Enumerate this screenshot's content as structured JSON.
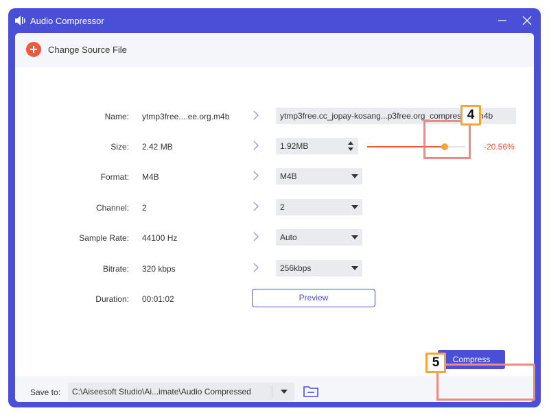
{
  "window": {
    "title": "Audio Compressor",
    "accent_color": "#4a4fd8",
    "icons": {
      "app": "audio-compress-icon",
      "minimize": "minimize-icon",
      "close": "close-icon"
    }
  },
  "toolbar": {
    "change_source_label": "Change Source File",
    "add_icon": "plus-icon"
  },
  "form": {
    "rows": [
      {
        "label": "Name:",
        "original": "ytmp3free....ee.org.m4b",
        "output": "ytmp3free.cc_jopay-kosang...p3free.org_compressed.m4b"
      },
      {
        "label": "Size:",
        "original": "2.42 MB",
        "output": "1.92MB"
      },
      {
        "label": "Format:",
        "original": "M4B",
        "output": "M4B"
      },
      {
        "label": "Channel:",
        "original": "2",
        "output": "2"
      },
      {
        "label": "Sample Rate:",
        "original": "44100 Hz",
        "output": "Auto"
      },
      {
        "label": "Bitrate:",
        "original": "320 kbps",
        "output": "256kbps"
      },
      {
        "label": "Duration:",
        "original": "00:01:02"
      }
    ],
    "size_slider": {
      "value_fraction": 0.79,
      "percent_label": "-20.56%"
    },
    "preview_label": "Preview"
  },
  "footer": {
    "save_to_label": "Save to:",
    "save_path": "C:\\Aiseesoft Studio\\Ai...imate\\Audio Compressed",
    "folder_icon": "folder-icon",
    "compress_label": "Compress"
  },
  "annotations": {
    "badge_4": "4",
    "badge_5": "5",
    "highlight_color": "#f08a80",
    "badge_border_color": "#f3a53b"
  }
}
